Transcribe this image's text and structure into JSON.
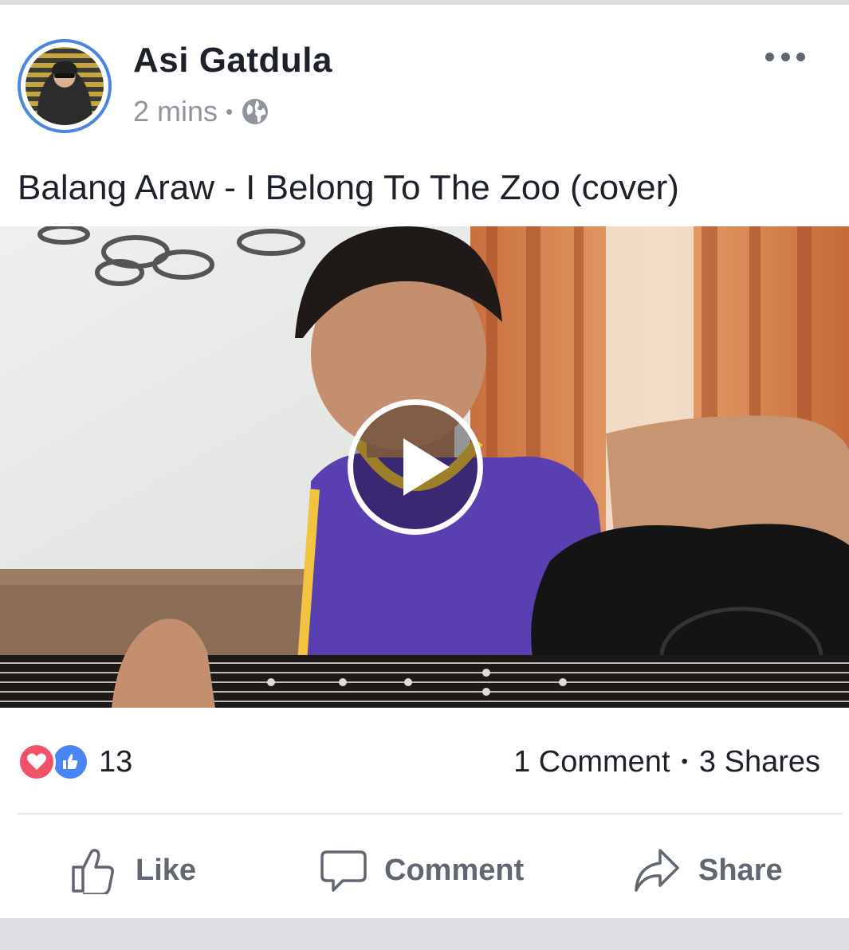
{
  "post": {
    "author": "Asi Gatdula",
    "time": "2 mins",
    "separator": "•",
    "audience_icon": "globe-icon",
    "text": "Balang Araw - I Belong To The Zoo (cover)",
    "video": {
      "description": "Young man singing while playing an acoustic guitar in front of orange curtains",
      "play_icon": "play-icon"
    },
    "reactions": {
      "icons": [
        "love-reaction-icon",
        "like-reaction-icon"
      ],
      "count": "13"
    },
    "comments": "1 Comment",
    "stats_separator": "•",
    "shares": "3 Shares"
  },
  "actions": {
    "like": "Like",
    "comment": "Comment",
    "share": "Share"
  },
  "colors": {
    "accent_blue": "#4a85f5",
    "love_red": "#f25268",
    "muted_text": "#90949c",
    "action_text": "#606770"
  }
}
